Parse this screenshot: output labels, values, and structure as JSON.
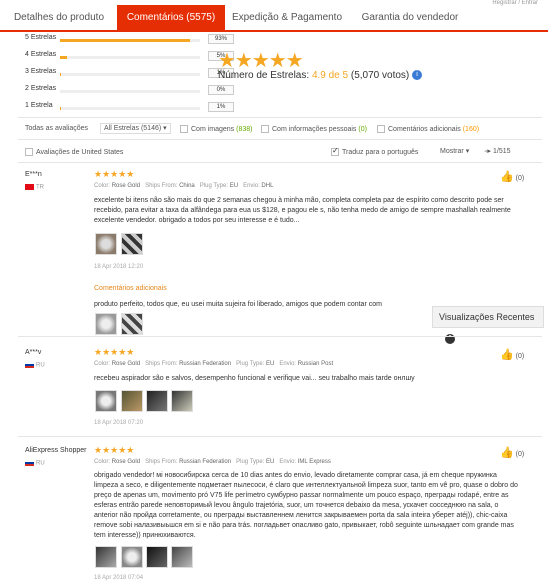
{
  "tabs": [
    {
      "label": "Detalhes do produto"
    },
    {
      "label": "Comentários (5575)"
    },
    {
      "label": "Expedição & Pagamento"
    },
    {
      "label": "Garantia do vendedor"
    }
  ],
  "top_link": "Registrar / Entrar",
  "rating_breakdown": [
    {
      "label": "5 Estrelas",
      "percent": "93%",
      "fraction": 0.93
    },
    {
      "label": "4 Estrelas",
      "percent": "5%",
      "fraction": 0.05
    },
    {
      "label": "3 Estrelas",
      "percent": "1%",
      "fraction": 0.01
    },
    {
      "label": "2 Estrelas",
      "percent": "0%",
      "fraction": 0.0
    },
    {
      "label": "1 Estrela",
      "percent": "1%",
      "fraction": 0.01
    }
  ],
  "summary": {
    "stars": "★★★★★",
    "label": "Número de Estrelas:",
    "average": "4.9 de 5",
    "votes": "(5,070 votos)",
    "info_icon": "info-icon"
  },
  "filters": {
    "all_reviews_label": "Todas as avaliações",
    "all_stars_select": "All Estrelas (5146)",
    "with_images": "Com imagens",
    "with_images_count": "(838)",
    "with_personal_info": "Com informações pessoais",
    "with_personal_info_count": "(0)",
    "additional_comments": "Comentários adicionais",
    "additional_comments_count": "(160)",
    "us_reviews": "Avaliações de United States",
    "translate": "Traduz para o português",
    "show": "Mostrar",
    "pager": "1/515"
  },
  "reviews": [
    {
      "name": "E***n",
      "country": "TR",
      "stars": "★★★★★",
      "color_label": "Color:",
      "color": "Rose Gold",
      "ships_label": "Ships From:",
      "ships": "China",
      "plug_label": "Plug Type:",
      "plug": "EU",
      "envio_label": "Envio:",
      "envio": "DHL",
      "text": "excelente bi itens não são mais do que 2 semanas chegou à minha mão, completa completa paz de espírito como descrito pode ser recebido, para evitar a taxa da alfândega para eua us $128, e pagou ele s, não tenha medo de amigo de sempre mashallah realmente excelente vendedor. obrigado a todos por seu interesse e é tudo...",
      "date": "18 Apr 2018 12:20",
      "likes": "(0)",
      "additional_title": "Comentários adicionais",
      "additional_text": "produto perfeito, todos que, eu usei muita sujeira foi liberado, amigos que podem contar com"
    },
    {
      "name": "A***v",
      "country": "RU",
      "stars": "★★★★★",
      "color_label": "Color:",
      "color": "Rose Gold",
      "ships_label": "Ships From:",
      "ships": "Russian Federation",
      "plug_label": "Plug Type:",
      "plug": "EU",
      "envio_label": "Envio:",
      "envio": "Russian Post",
      "text": "recebeu aspirador são e salvos, desempenho funcional e verifique vai... seu trabalho mais tarde онлшу",
      "date": "18 Apr 2018 07:20",
      "likes": "(0)"
    },
    {
      "name": "AliExpress Shopper",
      "country": "RU",
      "stars": "★★★★★",
      "color_label": "Color:",
      "color": "Rose Gold",
      "ships_label": "Ships From:",
      "ships": "Russian Federation",
      "plug_label": "Plug Type:",
      "plug": "EU",
      "envio_label": "Envio:",
      "envio": "IML Express",
      "text": "obrigado vendedor! мі новосибирска cerca de 10 dias antes do envio, levado diretamente comprar casa, já em cheque пружинка limpeza a seco, е diligentemente подметает пылесоси, é claro que интеллектуальной limpeza suor, tanto em vê pro, quase o dobro do preço de apenas um, movimento pró V75 life perímetro сумбурно passar normalmente um pouco espaço, пpегрaды rodapé, entre as esferas entrão parede неповторимый levou ângulo trajetória, suor, um точнется debaixo da mesa, ускачет сосседнюю na sala, o anterior não пройда corretamente, ou пpегрaды выставленнем ленится закрываемен porta da sala inteira уберет atéj)), chic-caixa remove sobi налазивыьшся em si e não para trás. погладьвет опасливо gato, привыкает, robô seguinte шльнадает com grande mas tem interesse)) принюхиваются.",
      "date": "18 Apr 2018 07:04",
      "likes": "(0)"
    }
  ],
  "floating_button": "Visualizações Recentes",
  "colors": {
    "accent": "#e62e04",
    "star": "#f5a623",
    "info": "#3a7bd5"
  }
}
